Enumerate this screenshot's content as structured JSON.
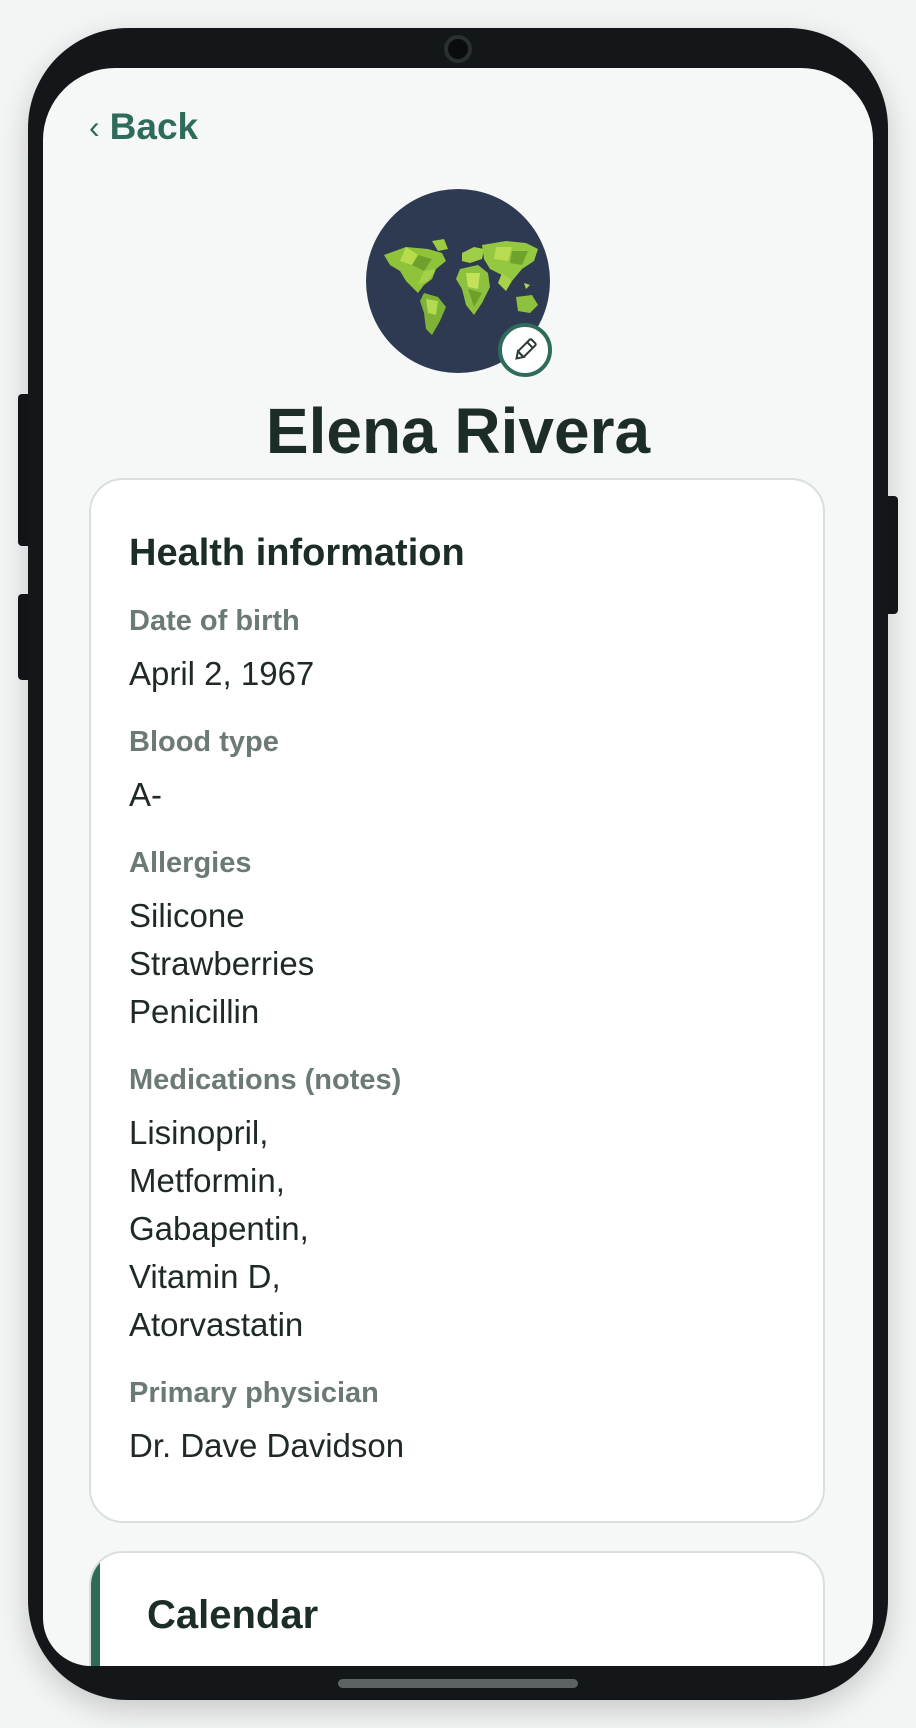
{
  "nav": {
    "back_label": "Back",
    "back_chevron": "‹"
  },
  "profile": {
    "name": "Elena Rivera",
    "avatar_icon": "world-map-icon",
    "edit_icon": "pencil-icon"
  },
  "health": {
    "title": "Health information",
    "fields": [
      {
        "label": "Date of birth",
        "values": [
          "April 2, 1967"
        ]
      },
      {
        "label": "Blood type",
        "values": [
          "A-"
        ]
      },
      {
        "label": "Allergies",
        "values": [
          "Silicone",
          "Strawberries",
          "Penicillin"
        ]
      },
      {
        "label": "Medications (notes)",
        "values": [
          "Lisinopril,",
          "Metformin,",
          "Gabapentin,",
          "Vitamin D,",
          "Atorvastatin"
        ]
      },
      {
        "label": "Primary physician",
        "values": [
          "Dr. Dave Davidson"
        ]
      }
    ]
  },
  "calendar": {
    "title": "Calendar"
  },
  "colors": {
    "accent": "#2e6b5a",
    "avatar_bg": "#2e3a52",
    "map_green": "#9acd32"
  }
}
